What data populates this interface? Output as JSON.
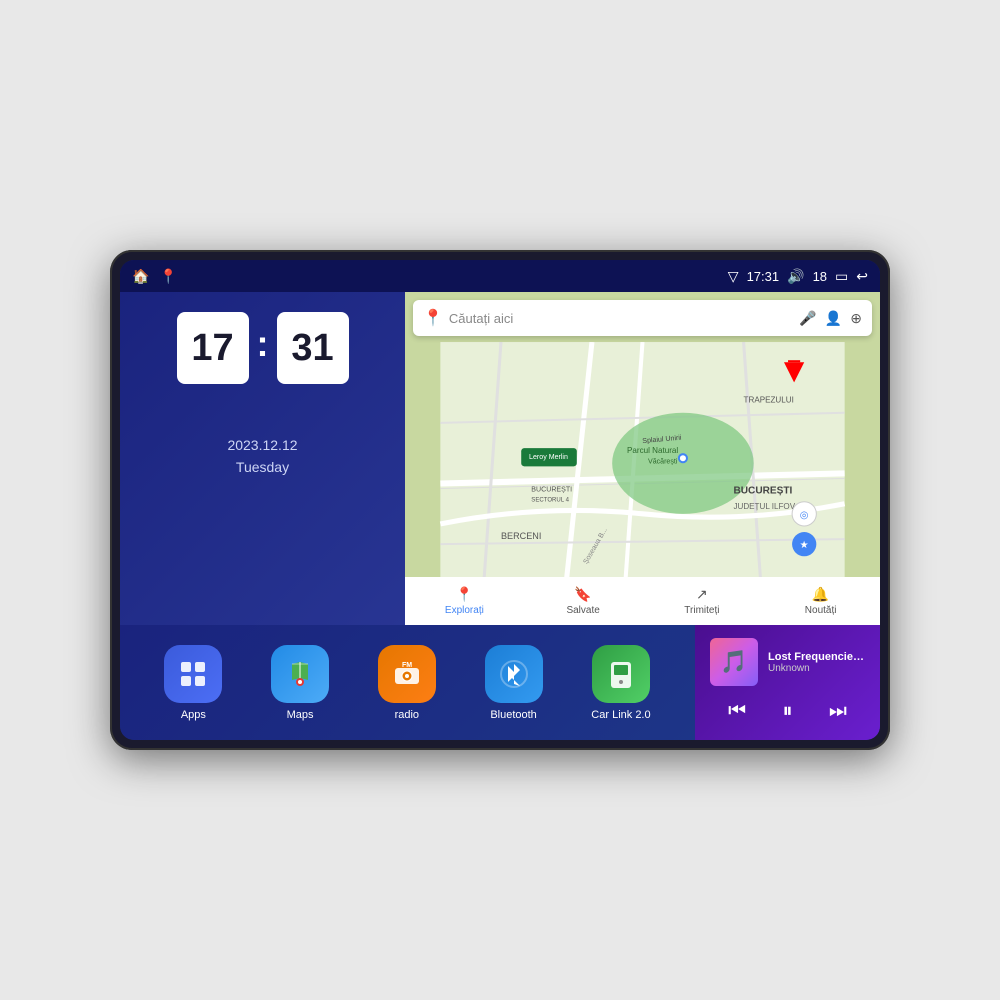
{
  "device": {
    "statusBar": {
      "leftIcons": [
        "🏠",
        "📍"
      ],
      "signal": "▽",
      "time": "17:31",
      "volume": "🔊",
      "battery_level": "18",
      "battery_icon": "🔋",
      "back": "↩"
    },
    "clock": {
      "hours": "17",
      "minutes": "31",
      "date": "2023.12.12",
      "day": "Tuesday"
    },
    "map": {
      "search_placeholder": "Căutați aici",
      "bottom_items": [
        {
          "label": "Explorați",
          "active": true
        },
        {
          "label": "Salvate",
          "active": false
        },
        {
          "label": "Trimiteți",
          "active": false
        },
        {
          "label": "Noutăți",
          "active": false
        }
      ]
    },
    "apps": [
      {
        "id": "apps",
        "label": "Apps",
        "icon": "⊞",
        "class": "icon-apps"
      },
      {
        "id": "maps",
        "label": "Maps",
        "icon": "📍",
        "class": "icon-maps"
      },
      {
        "id": "radio",
        "label": "radio",
        "icon": "📻",
        "class": "icon-radio"
      },
      {
        "id": "bluetooth",
        "label": "Bluetooth",
        "icon": "❋",
        "class": "icon-bluetooth"
      },
      {
        "id": "carlink",
        "label": "Car Link 2.0",
        "icon": "📱",
        "class": "icon-carlink"
      }
    ],
    "music": {
      "title": "Lost Frequencies_Janieck Devy-...",
      "artist": "Unknown",
      "prev": "⏮",
      "play_pause": "⏸",
      "next": "⏭"
    }
  }
}
